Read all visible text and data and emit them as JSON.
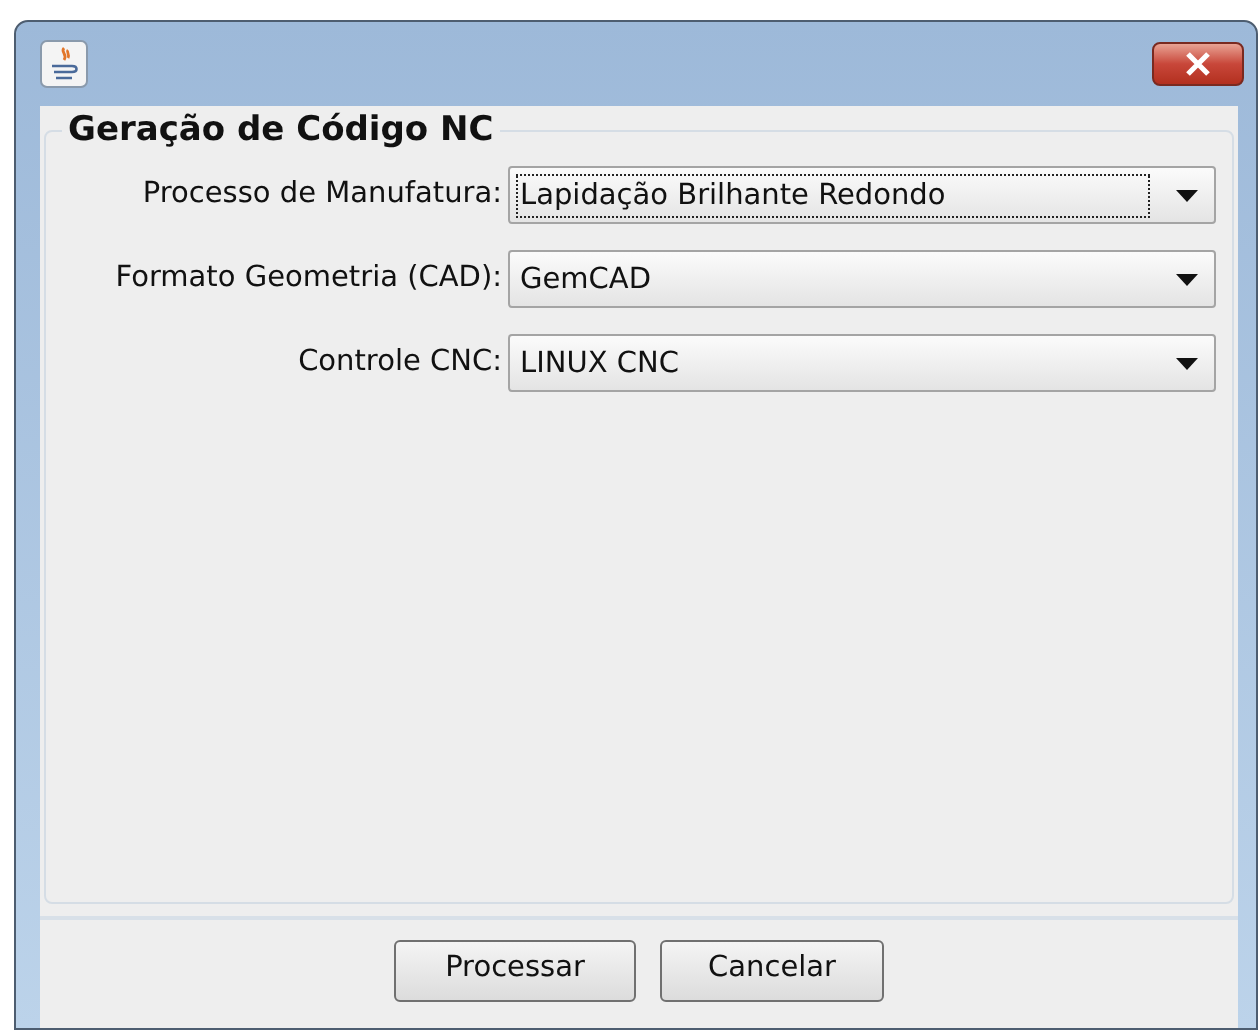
{
  "group": {
    "title": "Geração de Código NC",
    "fields": [
      {
        "label": "Processo de Manufatura:",
        "value": "Lapidação Brilhante Redondo",
        "focused": true
      },
      {
        "label": "Formato Geometria (CAD):",
        "value": "GemCAD",
        "focused": false
      },
      {
        "label": "Controle CNC:",
        "value": "LINUX CNC",
        "focused": false
      }
    ]
  },
  "buttons": [
    "Processar",
    "Cancelar"
  ]
}
